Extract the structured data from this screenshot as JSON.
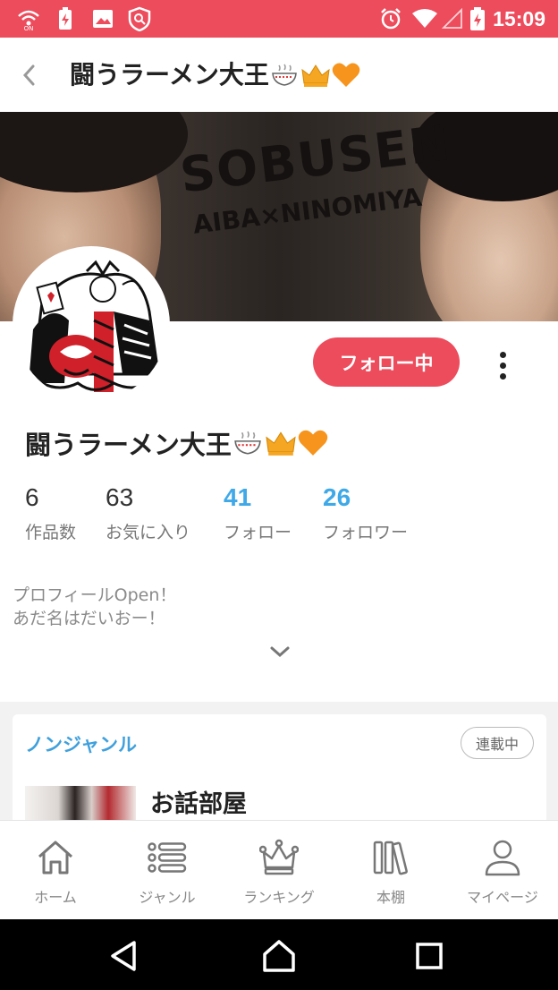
{
  "status_bar": {
    "time": "15:09",
    "left_icons": [
      "wifi-calling-icon",
      "battery-saver-icon",
      "image-icon",
      "shield-app-icon"
    ],
    "right_icons": [
      "alarm-icon",
      "wifi-icon",
      "cell-signal-icon",
      "battery-charging-icon"
    ]
  },
  "header": {
    "back_icon": "chevron-left-icon",
    "title": "闘うラーメン大王",
    "title_emoji": [
      "ramen-bowl-icon",
      "crown-icon",
      "orange-heart-icon"
    ]
  },
  "banner": {
    "line1": "SOBUSEN",
    "line2": "AIBA×NINOMIYA"
  },
  "profile": {
    "follow_button": "フォロー中",
    "more_icon": "more-vertical-icon",
    "name": "闘うラーメン大王",
    "stats": [
      {
        "value": "6",
        "label": "作品数",
        "highlight": false
      },
      {
        "value": "63",
        "label": "お気に入り",
        "highlight": false
      },
      {
        "value": "41",
        "label": "フォロー",
        "highlight": true
      },
      {
        "value": "26",
        "label": "フォロワー",
        "highlight": true
      }
    ],
    "bio_line1": "プロフィールOpen！",
    "bio_line2": "あだ名はだいおー！",
    "expand_icon": "chevron-down-icon"
  },
  "work_card": {
    "genre": "ノンジャンル",
    "badge": "連載中",
    "title": "お話部屋"
  },
  "bottom_nav": [
    {
      "label": "ホーム",
      "icon": "home-icon"
    },
    {
      "label": "ジャンル",
      "icon": "list-icon"
    },
    {
      "label": "ランキング",
      "icon": "crown-outline-icon"
    },
    {
      "label": "本棚",
      "icon": "bookshelf-icon"
    },
    {
      "label": "マイページ",
      "icon": "user-icon"
    }
  ],
  "colors": {
    "accent": "#ed4c5c",
    "link_blue": "#3fa9e8",
    "genre_blue": "#3fa0dc"
  }
}
